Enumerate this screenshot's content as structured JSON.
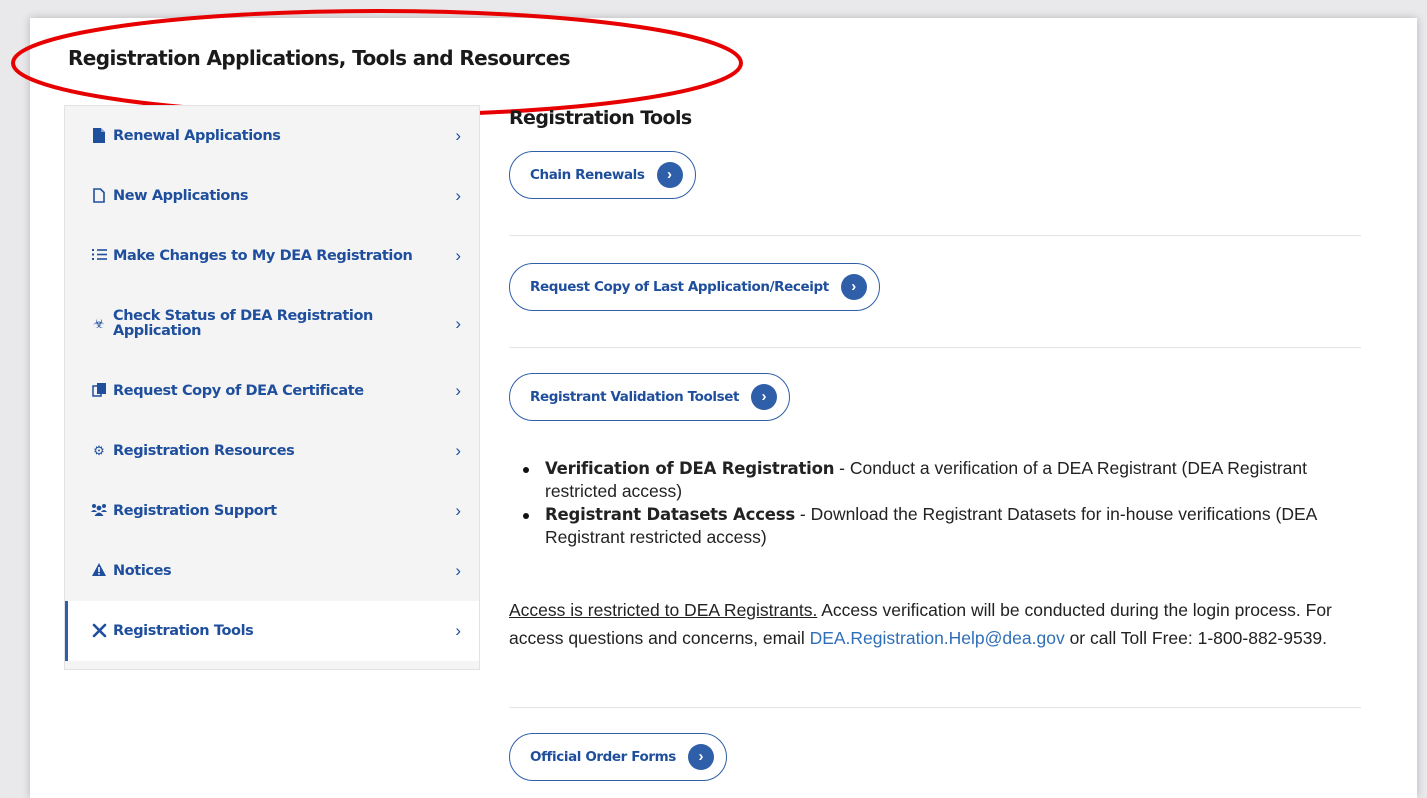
{
  "page": {
    "title": "Registration Applications, Tools and Resources"
  },
  "colors": {
    "accent": "#2f5fa8",
    "link": "#1f4f9c",
    "highlight": "#e60000"
  },
  "sidebar": {
    "items": [
      {
        "icon": "file-icon",
        "label": "Renewal Applications",
        "active": false
      },
      {
        "icon": "file-outline-icon",
        "label": "New Applications",
        "active": false
      },
      {
        "icon": "list-icon",
        "label": "Make Changes to My DEA Registration",
        "active": false
      },
      {
        "icon": "biohazard-icon",
        "label": "Check Status of DEA Registration Application",
        "active": false
      },
      {
        "icon": "copy-icon",
        "label": "Request Copy of DEA Certificate",
        "active": false
      },
      {
        "icon": "gears-icon",
        "label": "Registration Resources",
        "active": false
      },
      {
        "icon": "users-icon",
        "label": "Registration Support",
        "active": false
      },
      {
        "icon": "warning-icon",
        "label": "Notices",
        "active": false
      },
      {
        "icon": "tools-icon",
        "label": "Registration Tools",
        "active": true
      }
    ]
  },
  "main": {
    "section_title": "Registration Tools",
    "buttons": {
      "chain_renewals": "Chain Renewals",
      "request_copy": "Request Copy of Last Application/Receipt",
      "validation_toolset": "Registrant Validation Toolset",
      "order_forms": "Official Order Forms"
    },
    "bullets": [
      {
        "title": "Verification of DEA Registration",
        "text": " - Conduct a verification of a DEA Registrant (DEA Registrant restricted access)"
      },
      {
        "title": "Registrant Datasets Access",
        "text": " - Download the Registrant Datasets for in-house verifications (DEA Registrant restricted access)"
      }
    ],
    "access": {
      "restricted": "Access is restricted to DEA Registrants.",
      "text1": " Access verification will be conducted during the login process. For access questions and concerns, email ",
      "email": "DEA.Registration.Help@dea.gov",
      "text2": " or call Toll Free: 1-800-882-9539."
    }
  }
}
